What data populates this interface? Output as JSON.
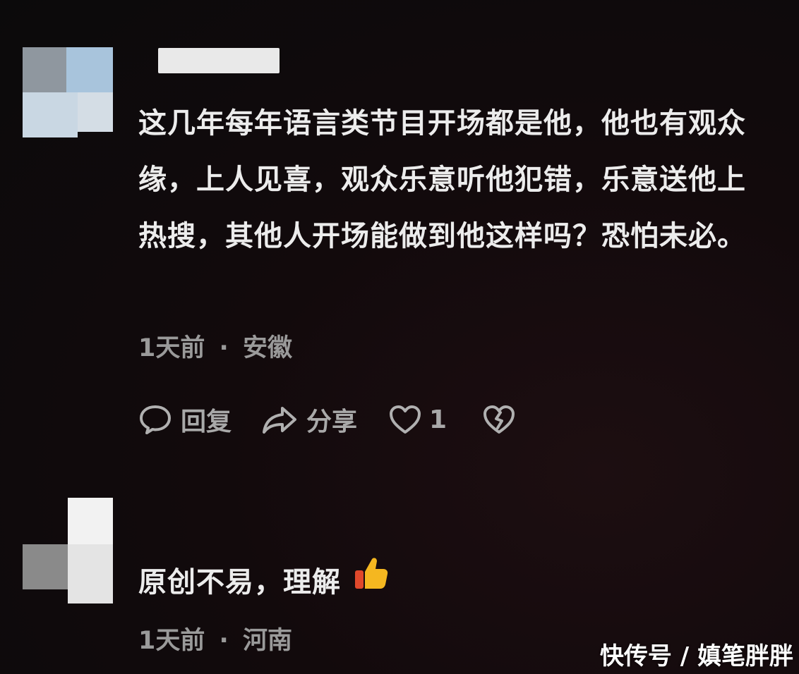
{
  "comments": [
    {
      "text": "这几年每年语言类节目开场都是他，他也有观众缘，上人见喜，观众乐意听他犯错，乐意送他上热搜，其他人开场能做到他这样吗？恐怕未必。",
      "time": "1天前",
      "separator": "·",
      "location": "安徽",
      "actions": {
        "reply_label": "回复",
        "share_label": "分享",
        "like_count": "1"
      }
    },
    {
      "text": "原创不易，理解",
      "emoji": "👍",
      "time": "1天前",
      "separator": "·",
      "location": "河南"
    }
  ],
  "watermark": "快传号 / 嫃笔胖胖",
  "icons": [
    "reply-icon",
    "share-icon",
    "like-heart-icon",
    "dislike-broken-heart-icon",
    "thumbs-up-emoji"
  ],
  "colors": {
    "background": "#0b0a0b",
    "text": "#ececec",
    "meta": "#9a9a9a"
  }
}
